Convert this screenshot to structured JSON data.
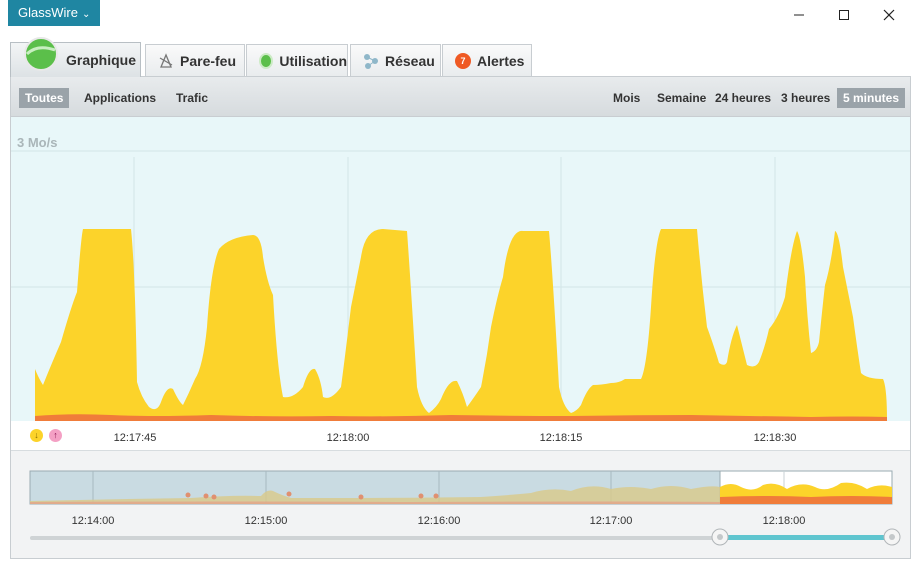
{
  "app": {
    "name": "GlassWire"
  },
  "tabs": [
    {
      "label": "Graphique",
      "icon": "graph-icon"
    },
    {
      "label": "Pare-feu",
      "icon": "firewall-icon"
    },
    {
      "label": "Utilisation",
      "icon": "usage-icon"
    },
    {
      "label": "Réseau",
      "icon": "network-icon"
    },
    {
      "label": "Alertes",
      "icon": "alert-icon",
      "badge": "7"
    }
  ],
  "filters": {
    "left": [
      "Toutes",
      "Applications",
      "Trafic"
    ],
    "left_selected": "Toutes"
  },
  "ranges": {
    "items": [
      "Mois",
      "Semaine",
      "24 heures",
      "3 heures",
      "5 minutes"
    ],
    "selected": "5 minutes"
  },
  "graph": {
    "scale_label": "3 Mo/s",
    "time_labels": [
      "12:17:45",
      "12:18:00",
      "12:18:15",
      "12:18:30"
    ],
    "download_color": "#fcd32a",
    "upload_color": "#f07c3a"
  },
  "overview": {
    "time_labels": [
      "12:14:00",
      "12:15:00",
      "12:16:00",
      "12:17:00",
      "12:18:00"
    ]
  },
  "legend": {
    "download_symbol": "↓",
    "upload_symbol": "↑"
  }
}
